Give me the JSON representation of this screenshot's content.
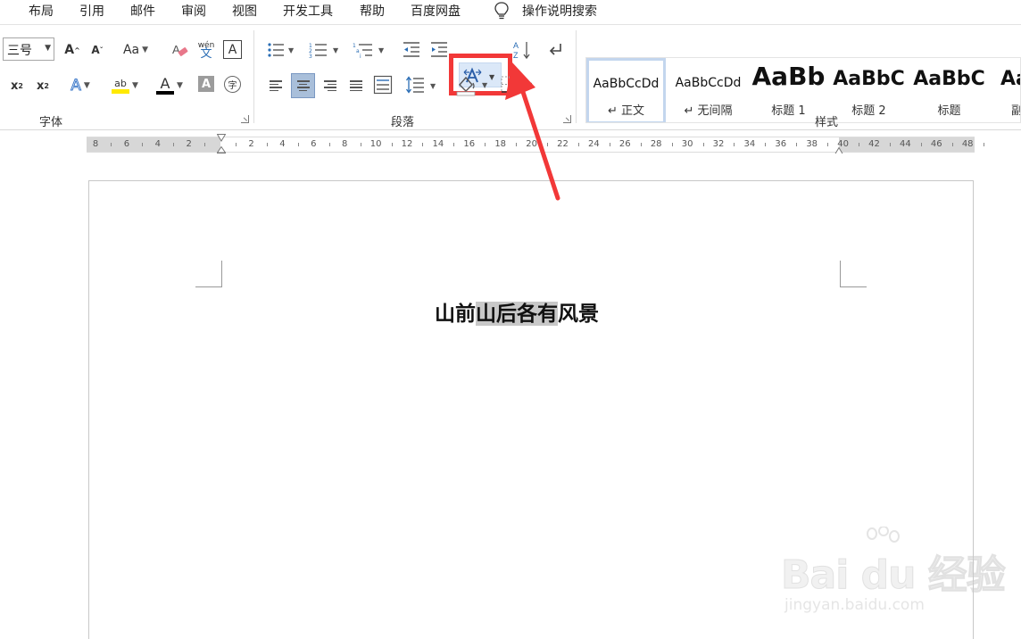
{
  "menubar": {
    "tabs": [
      "布局",
      "引用",
      "邮件",
      "审阅",
      "视图",
      "开发工具",
      "帮助",
      "百度网盘"
    ],
    "tell_me": "操作说明搜索"
  },
  "ribbon": {
    "font_group": {
      "label": "字体",
      "font_size": "三号",
      "grow_font": "A",
      "shrink_font": "A",
      "change_case": "Aa",
      "phonetic_top": "wén",
      "phonetic_bottom": "文",
      "char_border": "A",
      "subscript": "x",
      "superscript": "x",
      "text_effects": "A",
      "highlight": "ab",
      "font_color": "A",
      "char_shading": "A",
      "enclose_char": "字"
    },
    "paragraph_group": {
      "label": "段落"
    },
    "styles_group": {
      "label": "样式",
      "styles": [
        {
          "sample": "AaBbCcDd",
          "name": "↵ 正文"
        },
        {
          "sample": "AaBbCcDd",
          "name": "↵ 无间隔"
        },
        {
          "sample": "AaBb",
          "name": "标题 1"
        },
        {
          "sample": "AaBbC",
          "name": "标题 2"
        },
        {
          "sample": "AaBbC",
          "name": "标题"
        },
        {
          "sample": "Aa",
          "name": "副"
        }
      ]
    }
  },
  "ruler": {
    "labels": [
      "8",
      "6",
      "4",
      "2",
      "",
      "2",
      "4",
      "6",
      "8",
      "10",
      "12",
      "14",
      "16",
      "18",
      "20",
      "22",
      "24",
      "26",
      "28",
      "30",
      "32",
      "34",
      "36",
      "38",
      "40",
      "42",
      "44",
      "46",
      "48"
    ]
  },
  "document": {
    "before": "山前",
    "selected": "山后各有",
    "after": "风景"
  },
  "watermark": {
    "brand": "Bai du 经验",
    "url": "jingyan.baidu.com"
  },
  "colors": {
    "callout_red": "#f23838",
    "selection_gray": "#c8c8c8",
    "active_blue": "#dbe8f8"
  }
}
